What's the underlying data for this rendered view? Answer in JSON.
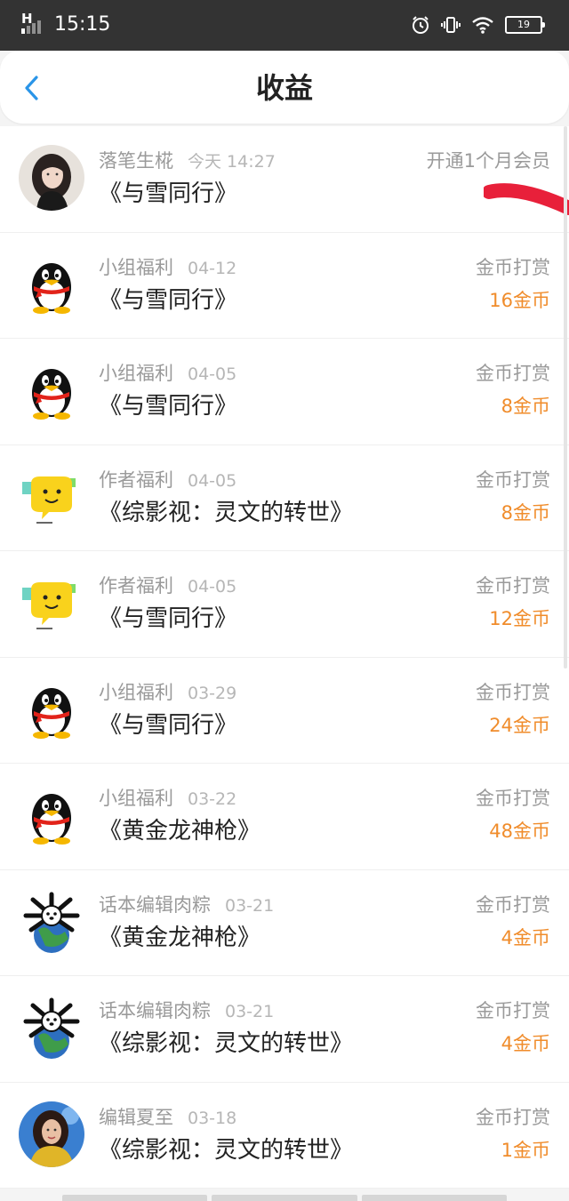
{
  "status_bar": {
    "time": "15:15",
    "network": "H",
    "battery": "19",
    "icons": [
      "signal-icon",
      "alarm-icon",
      "vibrate-icon",
      "wifi-icon",
      "battery-icon"
    ]
  },
  "header": {
    "title": "收益",
    "back_icon": "back-chevron-icon"
  },
  "colors": {
    "accent_blue": "#2a95e8",
    "amount_orange": "#f08c2b",
    "redaction_red": "#e8203a"
  },
  "records": [
    {
      "avatar": "photo-girl",
      "sender": "落笔生椛",
      "date": "今天 14:27",
      "book": "《与雪同行》",
      "type": "开通1个月会员",
      "amount": ""
    },
    {
      "avatar": "penguin",
      "sender": "小组福利",
      "date": "04-12",
      "book": "《与雪同行》",
      "type": "金币打赏",
      "amount": "16金币"
    },
    {
      "avatar": "penguin",
      "sender": "小组福利",
      "date": "04-05",
      "book": "《与雪同行》",
      "type": "金币打赏",
      "amount": "8金币"
    },
    {
      "avatar": "yellow-bubble",
      "sender": "作者福利",
      "date": "04-05",
      "book": "《综影视：灵文的转世》",
      "type": "金币打赏",
      "amount": "8金币"
    },
    {
      "avatar": "yellow-bubble",
      "sender": "作者福利",
      "date": "04-05",
      "book": "《与雪同行》",
      "type": "金币打赏",
      "amount": "12金币"
    },
    {
      "avatar": "penguin",
      "sender": "小组福利",
      "date": "03-29",
      "book": "《与雪同行》",
      "type": "金币打赏",
      "amount": "24金币"
    },
    {
      "avatar": "penguin",
      "sender": "小组福利",
      "date": "03-22",
      "book": "《黄金龙神枪》",
      "type": "金币打赏",
      "amount": "48金币"
    },
    {
      "avatar": "dog-globe",
      "sender": "话本编辑肉粽",
      "date": "03-21",
      "book": "《黄金龙神枪》",
      "type": "金币打赏",
      "amount": "4金币"
    },
    {
      "avatar": "dog-globe",
      "sender": "话本编辑肉粽",
      "date": "03-21",
      "book": "《综影视：灵文的转世》",
      "type": "金币打赏",
      "amount": "4金币"
    },
    {
      "avatar": "photo-woman",
      "sender": "编辑夏至",
      "date": "03-18",
      "book": "《综影视：灵文的转世》",
      "type": "金币打赏",
      "amount": "1金币"
    }
  ]
}
